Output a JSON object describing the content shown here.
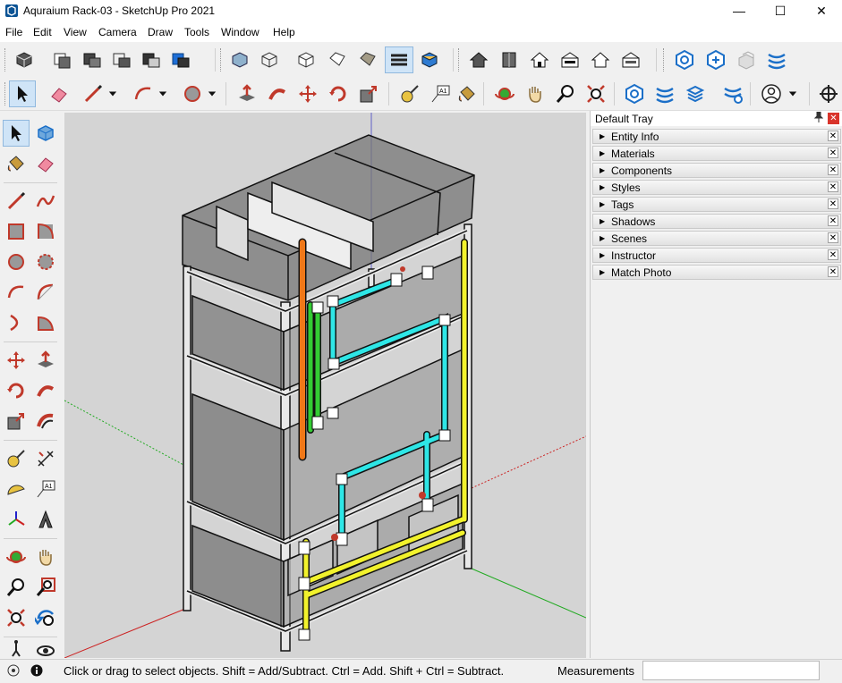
{
  "window": {
    "title": "Aquraium Rack-03 - SketchUp Pro 2021",
    "minimize": "—",
    "maximize": "☐",
    "close": "✕"
  },
  "menu": [
    "File",
    "Edit",
    "View",
    "Camera",
    "Draw",
    "Tools",
    "Window",
    "Help"
  ],
  "toolbar1": {
    "groups": [
      [
        "make-component",
        "paste-in-place",
        "cut",
        "copy",
        "paste"
      ],
      [
        "xray-style",
        "wireframe-style",
        "hidden-line-style",
        "shaded-style",
        "shaded-textures-style",
        "monochrome-style"
      ],
      [
        "iso-view",
        "top-view",
        "front-view",
        "right-view",
        "back-view",
        "left-view"
      ],
      [
        "warehouse",
        "extension-warehouse",
        "share-model",
        "layout"
      ]
    ]
  },
  "toolbar2": {
    "tools": [
      "select",
      "eraser",
      "line",
      "arc",
      "circle",
      "push-pull",
      "follow-me",
      "move",
      "rotate",
      "scale",
      "tape-measure",
      "text",
      "paint-bucket",
      "orbit",
      "pan",
      "zoom",
      "zoom-extents",
      "warehouse",
      "sandbox",
      "extension-manager",
      "outliner",
      "account",
      "position-camera"
    ]
  },
  "left_toolbar": [
    "select",
    "make-component",
    "paint-bucket",
    "eraser",
    "line",
    "freehand",
    "rectangle",
    "rotated-rectangle",
    "circle",
    "polygon",
    "arc",
    "2-point-arc",
    "3-point-arc",
    "pie",
    "move",
    "push-pull",
    "rotate",
    "follow-me",
    "scale",
    "offset",
    "tape-measure",
    "dimensions",
    "protractor",
    "text",
    "axes",
    "3d-text",
    "orbit",
    "pan",
    "zoom",
    "zoom-window",
    "zoom-extents",
    "previous",
    "position-camera",
    "look-around"
  ],
  "tray": {
    "title": "Default Tray",
    "pin": "📌",
    "close": "✕",
    "panels": [
      "Entity Info",
      "Materials",
      "Components",
      "Styles",
      "Tags",
      "Shadows",
      "Scenes",
      "Instructor",
      "Match Photo"
    ]
  },
  "status": {
    "message": "Click or drag to select objects. Shift = Add/Subtract. Ctrl = Add. Shift + Ctrl = Subtract.",
    "measurements_label": "Measurements",
    "measurements_value": ""
  },
  "colors": {
    "viewport_bg": "#d4d4d4",
    "axis_red": "#cc2222",
    "axis_green": "#22aa22",
    "axis_blue": "#2222cc",
    "pipe_cyan": "#2ee6e6",
    "pipe_yellow": "#f2f22c",
    "pipe_green": "#33cc33",
    "pipe_orange": "#f07818"
  }
}
